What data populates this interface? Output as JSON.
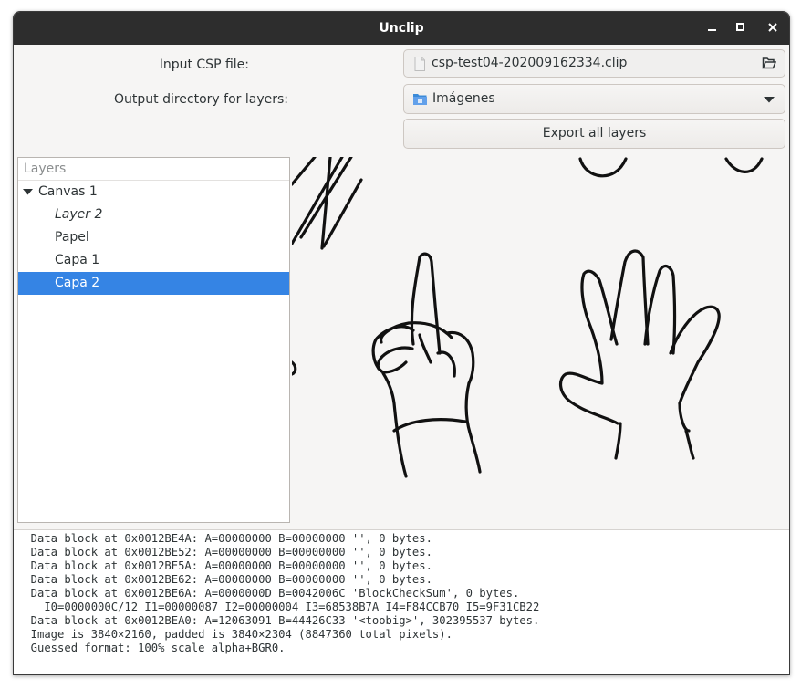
{
  "window": {
    "title": "Unclip",
    "minimize": "minimize",
    "maximize": "maximize",
    "close": "close"
  },
  "form": {
    "input_label": "Input CSP file:",
    "input_value": "csp-test04-202009162334.clip",
    "output_label": "Output directory for layers:",
    "output_value": "Imágenes",
    "export_button": "Export all layers"
  },
  "layers": {
    "header": "Layers",
    "root": "Canvas 1",
    "children": [
      "Layer 2",
      "Papel",
      "Capa 1",
      "Capa 2"
    ],
    "selected": "Capa 2"
  },
  "icons": {
    "file": "file-icon",
    "folder_open": "folder-open-icon",
    "folder": "folder-icon",
    "dropdown": "chevron-down-icon",
    "expander": "triangle-down-icon"
  },
  "colors": {
    "selection": "#3584e4",
    "titlebar": "#2d2d2d"
  },
  "log": {
    "lines": [
      "  Data block at 0x0012BE4A: A=00000000 B=00000000 '', 0 bytes.",
      "  Data block at 0x0012BE52: A=00000000 B=00000000 '', 0 bytes.",
      "  Data block at 0x0012BE5A: A=00000000 B=00000000 '', 0 bytes.",
      "  Data block at 0x0012BE62: A=00000000 B=00000000 '', 0 bytes.",
      "  Data block at 0x0012BE6A: A=0000000D B=0042006C 'BlockCheckSum', 0 bytes.",
      "    I0=0000000C/12 I1=00000087 I2=00000004 I3=68538B7A I4=F84CCB70 I5=9F31CB22",
      "  Data block at 0x0012BEA0: A=12063091 B=44426C33 '<toobig>', 302395537 bytes.",
      "  Image is 3840×2160, padded is 3840×2304 (8847360 total pixels).",
      "  Guessed format: 100% scale alpha+BGR0."
    ]
  }
}
